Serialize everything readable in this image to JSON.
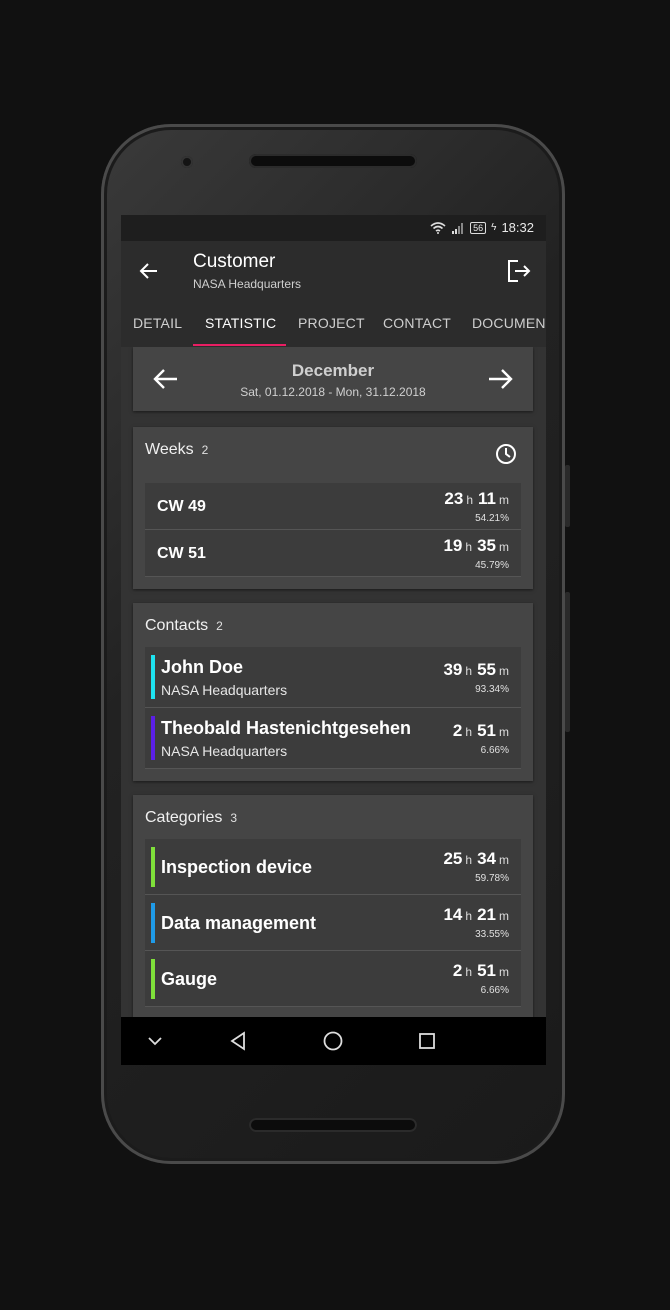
{
  "status": {
    "time": "18:32",
    "battery": "56"
  },
  "appbar": {
    "title": "Customer",
    "subtitle": "NASA Headquarters"
  },
  "tabs": [
    "DETAIL",
    "STATISTIC",
    "PROJECT",
    "CONTACT",
    "DOCUMENT"
  ],
  "active_tab": "STATISTIC",
  "month": {
    "name": "December",
    "range": "Sat, 01.12.2018 - Mon, 31.12.2018"
  },
  "weeks": {
    "title": "Weeks",
    "count": "2",
    "rows": [
      {
        "label": "CW 49",
        "hours": "23",
        "minutes": "11",
        "percent": "54.21%"
      },
      {
        "label": "CW 51",
        "hours": "19",
        "minutes": "35",
        "percent": "45.79%"
      }
    ]
  },
  "contacts": {
    "title": "Contacts",
    "count": "2",
    "rows": [
      {
        "name": "John Doe",
        "company": "NASA Headquarters",
        "hours": "39",
        "minutes": "55",
        "percent": "93.34%",
        "color": "#1ee3f0"
      },
      {
        "name": "Theobald Hastenichtgesehen",
        "company": "NASA Headquarters",
        "hours": "2",
        "minutes": "51",
        "percent": "6.66%",
        "color": "#5b1fe6"
      }
    ]
  },
  "categories": {
    "title": "Categories",
    "count": "3",
    "rows": [
      {
        "name": "Inspection device",
        "hours": "25",
        "minutes": "34",
        "percent": "59.78%",
        "color": "#7fe03a"
      },
      {
        "name": "Data management",
        "hours": "14",
        "minutes": "21",
        "percent": "33.55%",
        "color": "#1f9be8"
      },
      {
        "name": "Gauge",
        "hours": "2",
        "minutes": "51",
        "percent": "6.66%",
        "color": "#7fe03a"
      }
    ]
  },
  "units": {
    "hours": "h",
    "minutes": "m"
  }
}
